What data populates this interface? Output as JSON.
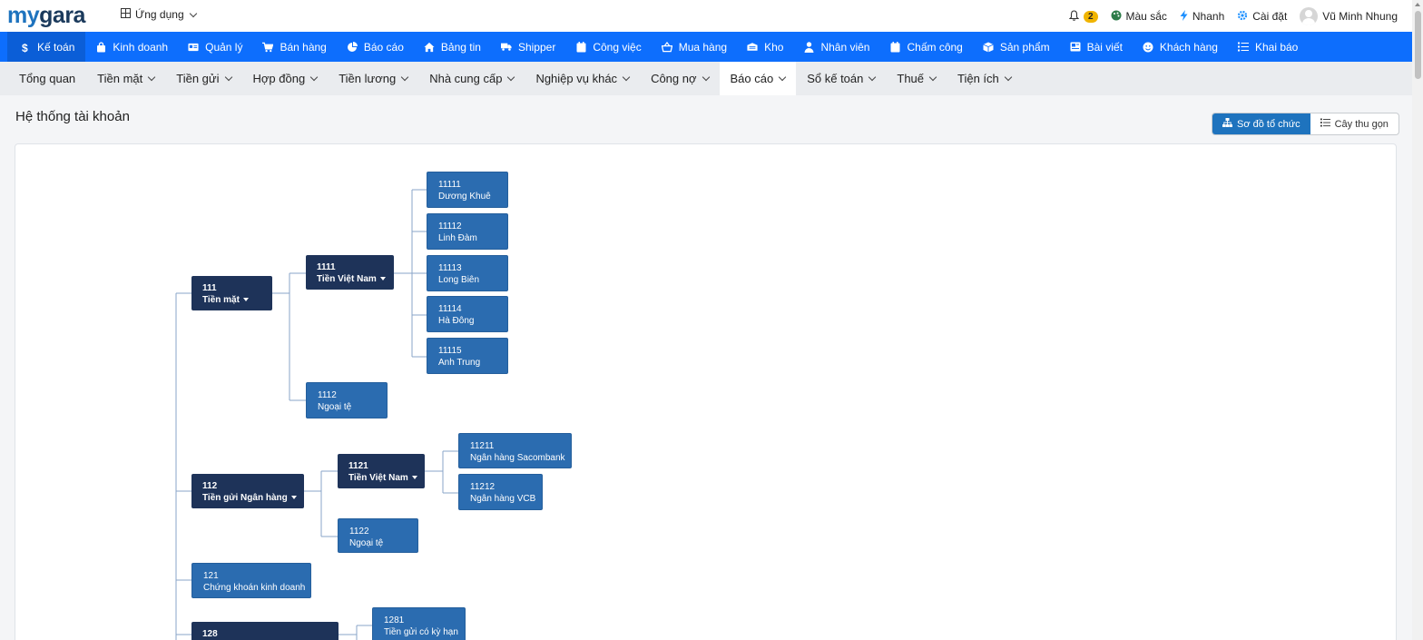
{
  "header": {
    "logo_my": "my",
    "logo_gara": "gara",
    "apps_label": "Ứng dụng",
    "notification_count": "2",
    "color_label": "Màu sắc",
    "quick_label": "Nhanh",
    "settings_label": "Cài đặt",
    "user_name": "Vũ Minh Nhung"
  },
  "main_nav": [
    {
      "label": "Kế toán",
      "icon": "dollar-icon"
    },
    {
      "label": "Kinh doanh",
      "icon": "bag-icon"
    },
    {
      "label": "Quản lý",
      "icon": "id-card-icon"
    },
    {
      "label": "Bán hàng",
      "icon": "cart-icon"
    },
    {
      "label": "Báo cáo",
      "icon": "pie-chart-icon"
    },
    {
      "label": "Bảng tin",
      "icon": "home-icon"
    },
    {
      "label": "Shipper",
      "icon": "truck-icon"
    },
    {
      "label": "Công việc",
      "icon": "calendar-icon"
    },
    {
      "label": "Mua hàng",
      "icon": "basket-icon"
    },
    {
      "label": "Kho",
      "icon": "warehouse-icon"
    },
    {
      "label": "Nhân viên",
      "icon": "user-icon"
    },
    {
      "label": "Chấm công",
      "icon": "calendar-check-icon"
    },
    {
      "label": "Sản phẩm",
      "icon": "box-icon"
    },
    {
      "label": "Bài viết",
      "icon": "newspaper-icon"
    },
    {
      "label": "Khách hàng",
      "icon": "smile-icon"
    },
    {
      "label": "Khai báo",
      "icon": "list-icon"
    }
  ],
  "sub_nav": [
    {
      "label": "Tổng quan"
    },
    {
      "label": "Tiền mặt"
    },
    {
      "label": "Tiền gửi"
    },
    {
      "label": "Hợp đồng"
    },
    {
      "label": "Tiền lương"
    },
    {
      "label": "Nhà cung cấp"
    },
    {
      "label": "Nghiệp vụ khác"
    },
    {
      "label": "Công nợ"
    },
    {
      "label": "Báo cáo"
    },
    {
      "label": "Sổ kế toán"
    },
    {
      "label": "Thuế"
    },
    {
      "label": "Tiện ích"
    }
  ],
  "page": {
    "title": "Hệ thống tài khoản",
    "view_org_chart": "Sơ đồ tổ chức",
    "view_tree": "Cây thu gọn"
  },
  "accounts": {
    "a111": {
      "code": "111",
      "name": "Tiền mặt"
    },
    "a1111": {
      "code": "1111",
      "name": "Tiền Việt Nam"
    },
    "a11111": {
      "code": "11111",
      "name": "Dương Khuê"
    },
    "a11112": {
      "code": "11112",
      "name": "Linh Đàm"
    },
    "a11113": {
      "code": "11113",
      "name": "Long Biên"
    },
    "a11114": {
      "code": "11114",
      "name": "Hà Đông"
    },
    "a11115": {
      "code": "11115",
      "name": "Anh Trung"
    },
    "a1112": {
      "code": "1112",
      "name": "Ngoại tệ"
    },
    "a112": {
      "code": "112",
      "name": "Tiền gửi Ngân hàng"
    },
    "a1121": {
      "code": "1121",
      "name": "Tiền Việt Nam"
    },
    "a11211": {
      "code": "11211",
      "name": "Ngân hàng Sacombank"
    },
    "a11212": {
      "code": "11212",
      "name": "Ngân hàng VCB"
    },
    "a1122": {
      "code": "1122",
      "name": "Ngoại tệ"
    },
    "a121": {
      "code": "121",
      "name": "Chứng khoán kinh doanh"
    },
    "a128": {
      "code": "128",
      "name": ""
    },
    "a1281": {
      "code": "1281",
      "name": "Tiền gửi có kỳ hạn"
    }
  }
}
